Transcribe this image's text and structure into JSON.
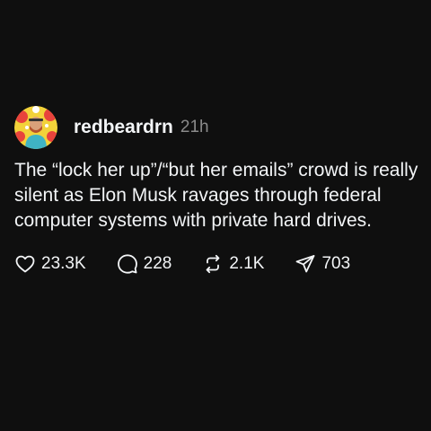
{
  "post": {
    "username": "redbeardrn",
    "timestamp": "21h",
    "text": "The “lock her up”/“but her emails” crowd is really silent as Elon Musk ravages through federal computer systems with private hard drives.",
    "avatar_icon": "user-avatar-photo",
    "actions": {
      "likes": {
        "icon": "heart-icon",
        "count": "23.3K"
      },
      "replies": {
        "icon": "comment-icon",
        "count": "228"
      },
      "reposts": {
        "icon": "repost-icon",
        "count": "2.1K"
      },
      "shares": {
        "icon": "send-icon",
        "count": "703"
      }
    }
  },
  "colors": {
    "background": "#0f0f0f",
    "text": "#f3f5f7",
    "muted": "#8a8a8a"
  }
}
